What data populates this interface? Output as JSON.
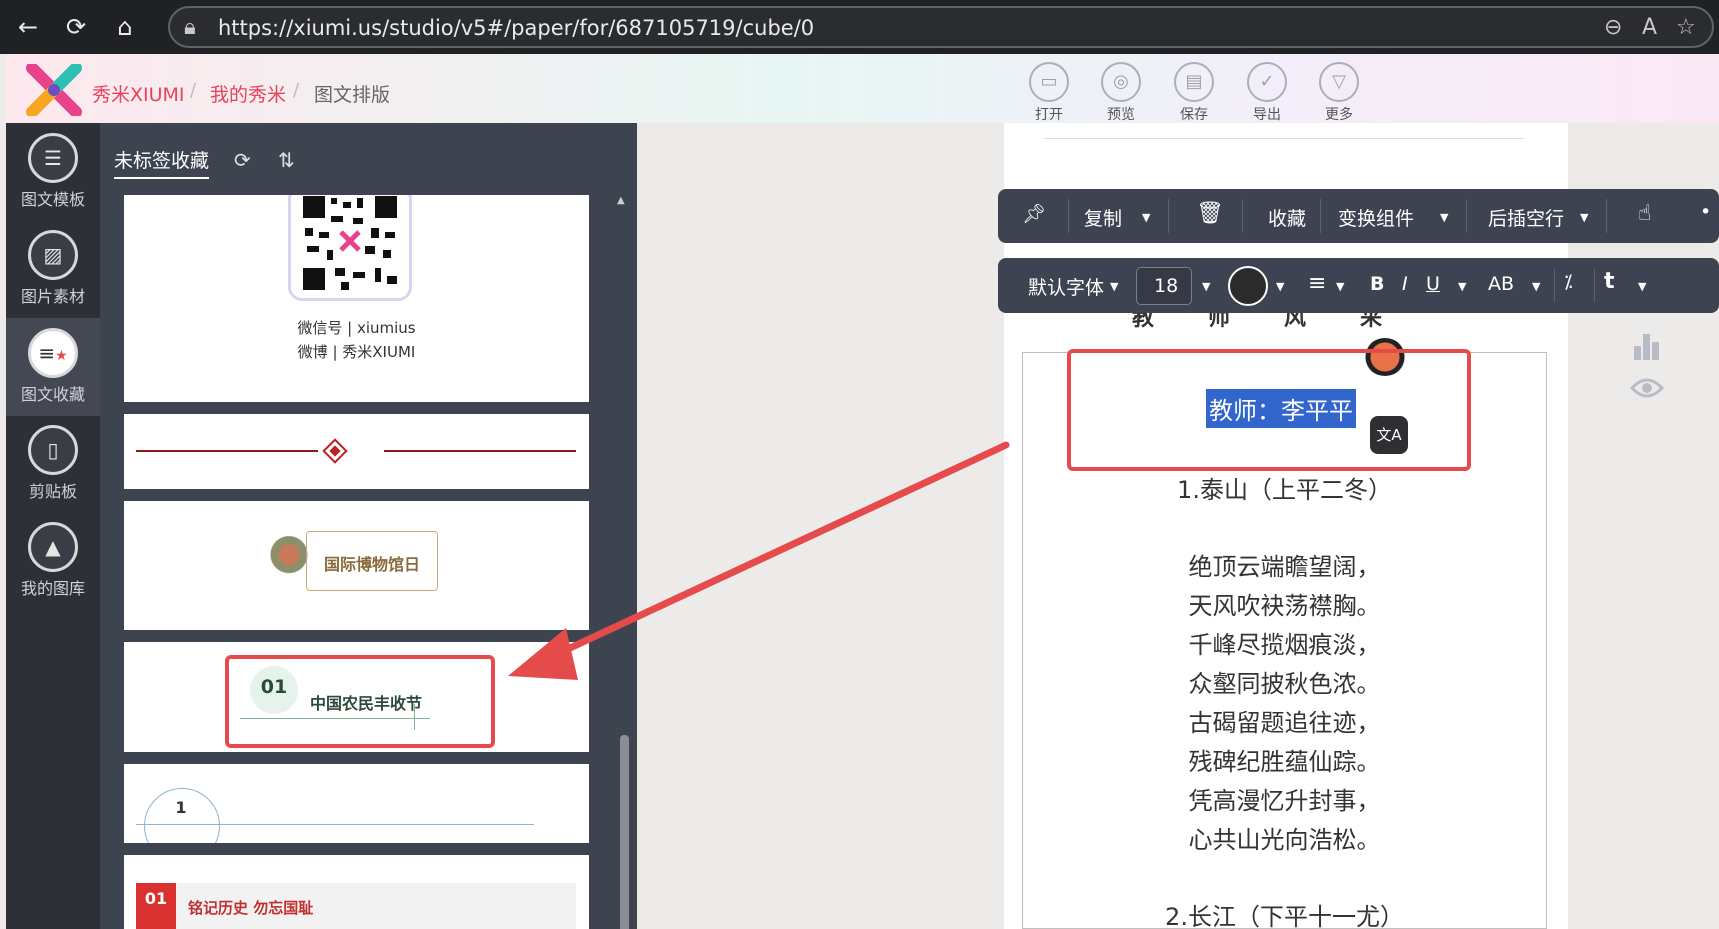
{
  "browser": {
    "url": "https://xiumi.us/studio/v5#/paper/for/687105719/cube/0"
  },
  "header": {
    "breadcrumbs": [
      "秀米XIUMI",
      "我的秀米",
      "图文排版"
    ],
    "tools": [
      {
        "label": "打开",
        "icon": "folder-icon"
      },
      {
        "label": "预览",
        "icon": "preview-icon"
      },
      {
        "label": "保存",
        "icon": "save-icon"
      },
      {
        "label": "导出",
        "icon": "check-icon"
      },
      {
        "label": "更多",
        "icon": "chevron-down-icon"
      }
    ]
  },
  "leftnav": {
    "items": [
      {
        "label": "图文模板",
        "icon": "list-icon"
      },
      {
        "label": "图片素材",
        "icon": "image-icon"
      },
      {
        "label": "图文收藏",
        "icon": "favorites-icon"
      },
      {
        "label": "剪贴板",
        "icon": "clipboard-icon"
      },
      {
        "label": "我的图库",
        "icon": "gallery-icon"
      }
    ],
    "active": 2
  },
  "panel": {
    "tab": "未标签收藏",
    "cards": {
      "wechat": "微信号 | xiumius",
      "weibo": "微博 | 秀米XIUMI",
      "museum": "国际博物馆日",
      "festival_num": "01",
      "festival": "中国农民丰收节",
      "number_one": "1",
      "remember_num": "01",
      "remember": "铭记历史 勿忘国耻"
    }
  },
  "toolbar1": {
    "copy": "复制",
    "collect": "收藏",
    "transform": "变换组件",
    "insert_after": "后插空行"
  },
  "toolbar2": {
    "font": "默认字体",
    "size": "18",
    "bold": "B",
    "italic": "I",
    "underline": "U",
    "caps": "AB"
  },
  "canvas": {
    "header_chars": [
      "教",
      "师",
      "风",
      "采"
    ],
    "teacher": "教师：李平平",
    "poem1_title": "1.泰山（上平二冬）",
    "poem1_lines": [
      "绝顶云端瞻望阔，",
      "天风吹袂荡襟胸。",
      "千峰尽揽烟痕淡，",
      "众壑同披秋色浓。",
      "古碣留题追往迹，",
      "残碑纪胜蕴仙踪。",
      "凭高漫忆升封事，",
      "心共山光向浩松。"
    ],
    "poem2_title": "2.长江（下平十一尤）"
  },
  "colors": {
    "accent_red": "#e54b4b",
    "toolbar_bg": "#3d4350",
    "selection": "#3366cc"
  }
}
